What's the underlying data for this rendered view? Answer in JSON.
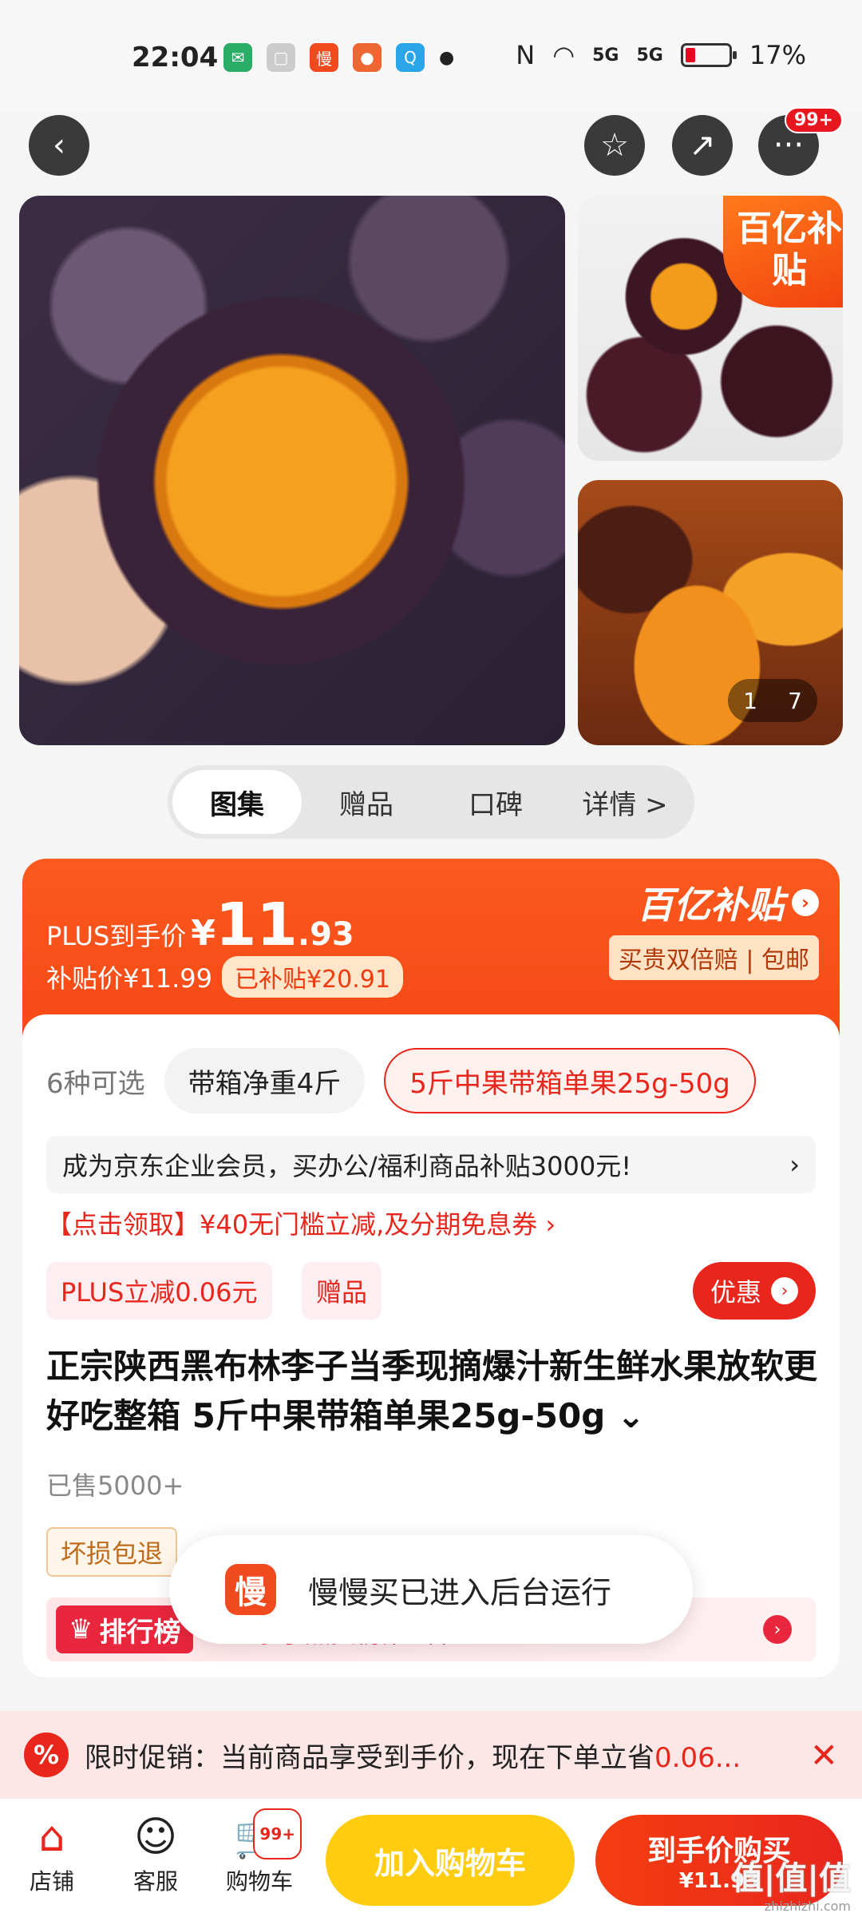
{
  "status_bar": {
    "time": "22:04",
    "battery": "17%",
    "network": [
      "5G",
      "5G"
    ]
  },
  "nav": {
    "more_badge": "99+"
  },
  "gallery": {
    "subsidy_tag": "百亿补贴",
    "page_current": "1",
    "page_total": "7"
  },
  "tabs": [
    "图集",
    "赠品",
    "口碑",
    "详情 >"
  ],
  "price": {
    "plus_label": "PLUS到手价",
    "yen": "¥",
    "plus_int": "11",
    "plus_dec": ".93",
    "subsidy_price_label": "补贴价¥11.99",
    "subsidized": "已补贴¥20.91",
    "brand": "百亿补贴",
    "guarantee": "买贵双倍赔 | 包邮"
  },
  "specs": {
    "count": "6种可选",
    "option1": "带箱净重4斤",
    "option2": "5斤中果带箱单果25g-50g"
  },
  "enterprise": {
    "text": "成为京东企业会员，买办公/福利商品补贴3000元!",
    "arrow": "›"
  },
  "coupon": "【点击领取】¥40无门槛立减,及分期免息券 ›",
  "tags": {
    "plus": "PLUS立减0.06元",
    "gift": "赠品",
    "youhui": "优惠"
  },
  "product": {
    "title": "正宗陕西黑布林李子当季现摘爆汁新生鲜水果放软更好吃整箱 5斤中果带箱单果25g-50g ⌄",
    "sold": "已售5000+",
    "damage": "坏损包退",
    "rank_badge": "排行榜",
    "rank_text": "李子热卖榜第5名"
  },
  "toast": {
    "icon": "慢",
    "text": "慢慢买已进入后台运行"
  },
  "promo": {
    "icon": "%",
    "text": "限时促销：当前商品享受到手价，现在下单立省",
    "highlight": "0.06...",
    "close": "✕"
  },
  "bottom": {
    "shop": "店铺",
    "service": "客服",
    "cart": "购物车",
    "cart_badge": "99+",
    "add_cart": "加入购物车",
    "buy_line1": "到手价购买",
    "buy_line2": "¥11.93",
    "watermark": "值|值|值",
    "watermark_url": "zhizhizhi.com"
  }
}
